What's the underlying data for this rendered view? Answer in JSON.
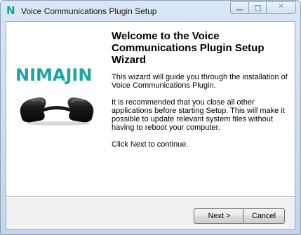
{
  "window": {
    "title": "Voice Communications Plugin Setup",
    "icon": "nimajin-n-icon",
    "icon_glyph": "N"
  },
  "branding": {
    "logo_text": "NIMAJIN",
    "logo_color": "#1aa6a6",
    "image": "telephone-handset-icon"
  },
  "main": {
    "heading": "Welcome to the Voice Communications Plugin Setup Wizard",
    "paragraphs": [
      "This wizard will guide you through the installation of Voice Communications Plugin.",
      "It is recommended that you close all other applications before starting Setup. This will make it possible to update relevant system files without having to reboot your computer.",
      "Click Next to continue."
    ]
  },
  "buttons": {
    "next": "Next >",
    "cancel": "Cancel"
  }
}
